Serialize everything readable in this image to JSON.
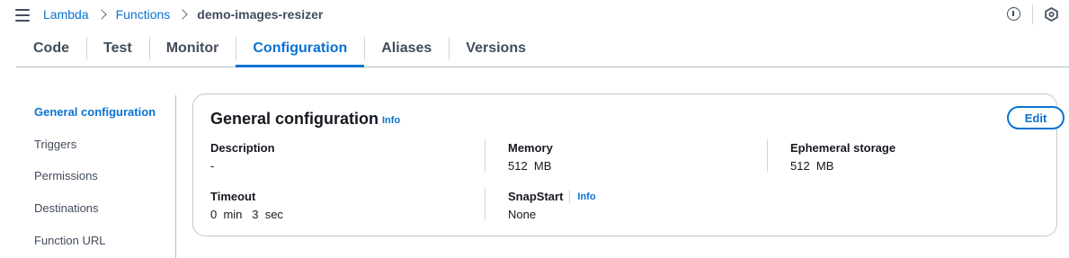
{
  "topbar": {
    "breadcrumbs": [
      "Lambda",
      "Functions"
    ],
    "current": "demo-images-resizer",
    "icons": [
      "menu-icon",
      "info-icon",
      "settings-hexagon-icon"
    ]
  },
  "tabs": [
    "Code",
    "Test",
    "Monitor",
    "Configuration",
    "Aliases",
    "Versions"
  ],
  "active_tab": "Configuration",
  "sidenav": {
    "items": [
      "General configuration",
      "Triggers",
      "Permissions",
      "Destinations",
      "Function URL"
    ],
    "active": "General configuration"
  },
  "card": {
    "title": "General configuration",
    "info_label": "Info",
    "edit_label": "Edit",
    "fields": {
      "description": {
        "label": "Description",
        "value": "-"
      },
      "memory": {
        "label": "Memory",
        "value": "512  MB"
      },
      "ephemeral": {
        "label": "Ephemeral storage",
        "value": "512  MB"
      },
      "timeout": {
        "label": "Timeout",
        "value": "0  min   3  sec"
      },
      "snapstart": {
        "label": "SnapStart",
        "info_label": "Info",
        "value": "None"
      }
    }
  },
  "colors": {
    "accent": "#0972d3",
    "text": "#16191f",
    "muted": "#414d5c",
    "border": "#b6bec9"
  }
}
